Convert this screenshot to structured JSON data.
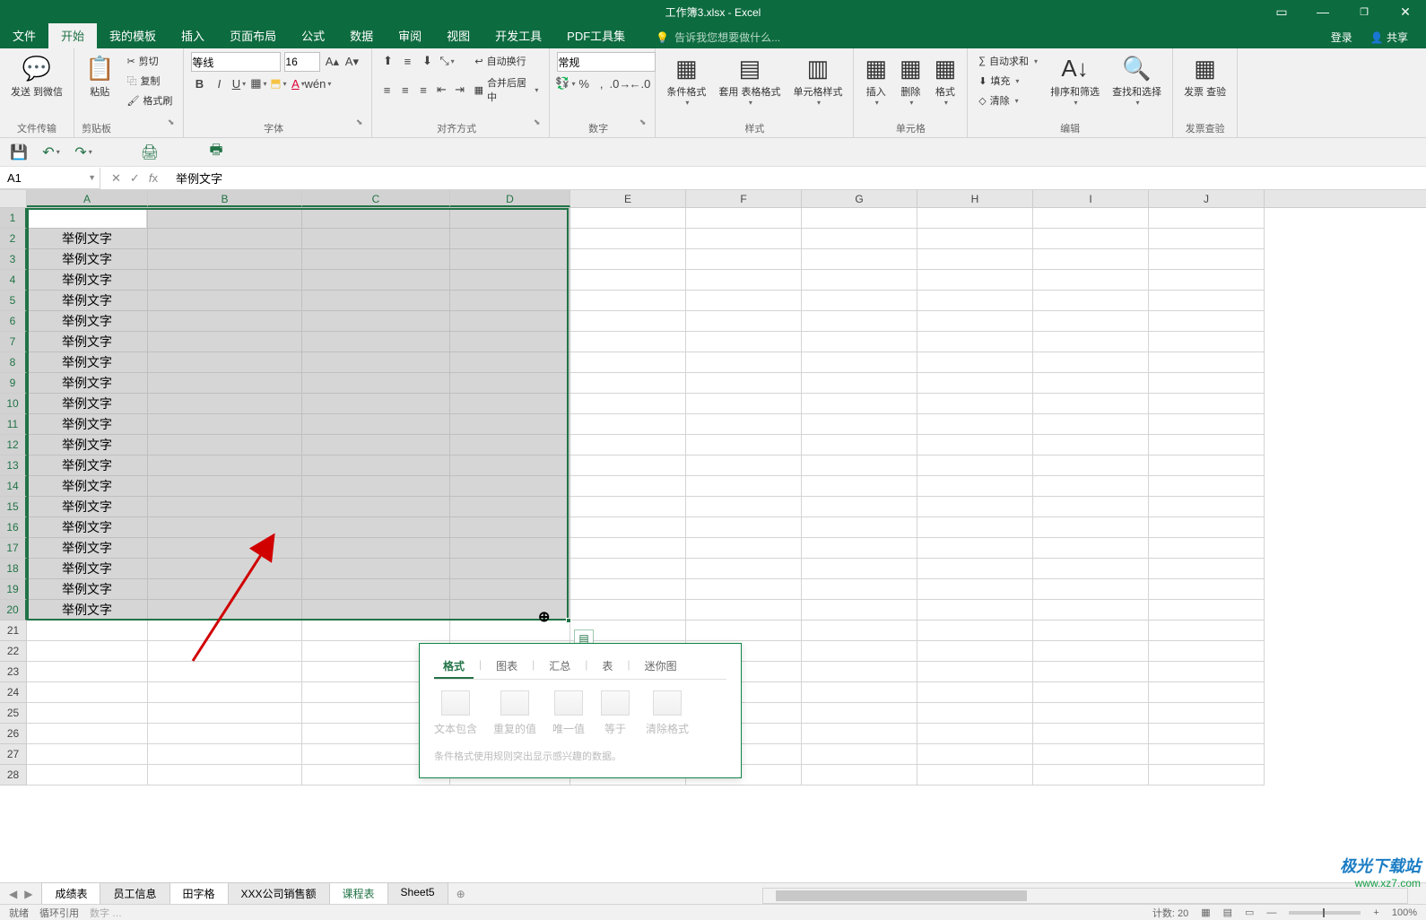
{
  "title": "工作簿3.xlsx - Excel",
  "tabs": [
    "文件",
    "开始",
    "我的模板",
    "插入",
    "页面布局",
    "公式",
    "数据",
    "审阅",
    "视图",
    "开发工具",
    "PDF工具集"
  ],
  "active_tab_index": 1,
  "tell_me": "告诉我您想要做什么...",
  "login": "登录",
  "share": "共享",
  "ribbon": {
    "file_transfer": {
      "big": "发送\n到微信",
      "label": "文件传输"
    },
    "clipboard": {
      "paste": "粘贴",
      "cut": "剪切",
      "copy": "复制",
      "painter": "格式刷",
      "label": "剪贴板"
    },
    "font": {
      "name": "等线",
      "size": "16",
      "label": "字体"
    },
    "align": {
      "wrap": "自动换行",
      "merge": "合并后居中",
      "label": "对齐方式"
    },
    "number": {
      "format": "常规",
      "label": "数字"
    },
    "styles": {
      "cond": "条件格式",
      "table": "套用\n表格格式",
      "cell": "单元格样式",
      "label": "样式"
    },
    "cells": {
      "insert": "插入",
      "delete": "删除",
      "format": "格式",
      "label": "单元格"
    },
    "editing": {
      "sum": "自动求和",
      "fill": "填充",
      "clear": "清除",
      "sort": "排序和筛选",
      "find": "查找和选择",
      "label": "编辑"
    },
    "invoice": {
      "check": "发票\n查验",
      "label": "发票查验"
    }
  },
  "name_box": "A1",
  "formula": "举例文字",
  "columns": [
    "A",
    "B",
    "C",
    "D",
    "E",
    "F",
    "G",
    "H",
    "I",
    "J"
  ],
  "rows_count": 28,
  "selection": {
    "rows": 20,
    "cols": 4
  },
  "cell_text": "举例文字",
  "qa": {
    "tabs": [
      "格式",
      "图表",
      "汇总",
      "表",
      "迷你图"
    ],
    "active": 0,
    "items": [
      "文本包含",
      "重复的值",
      "唯一值",
      "等于",
      "清除格式"
    ],
    "desc": "条件格式使用规则突出显示感兴趣的数据。"
  },
  "sheets": [
    "成绩表",
    "员工信息",
    "田字格",
    "XXX公司销售额",
    "课程表",
    "Sheet5"
  ],
  "active_sheet_index": 4,
  "status": {
    "ready": "就绪",
    "circ": "循环引用",
    "count_label": "计数:",
    "count": "20",
    "zoom": "100%"
  },
  "watermark": {
    "l1": "极光下载站",
    "l2": "www.xz7.com"
  }
}
